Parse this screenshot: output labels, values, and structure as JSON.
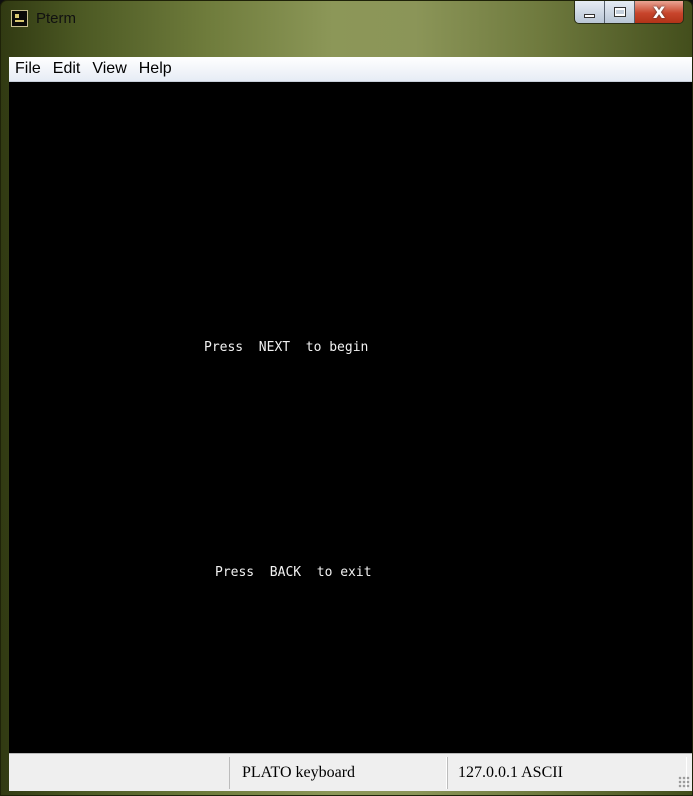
{
  "window": {
    "title": "Pterm",
    "controls": {
      "minimize": "minimize-icon",
      "maximize": "maximize-icon",
      "close": "X"
    }
  },
  "menu": {
    "items": [
      "File",
      "Edit",
      "View",
      "Help"
    ]
  },
  "terminal": {
    "lines": [
      "Press  NEXT  to begin",
      "Press  BACK  to exit"
    ]
  },
  "status": {
    "keyboard": "PLATO keyboard",
    "connection": "127.0.0.1 ASCII"
  }
}
